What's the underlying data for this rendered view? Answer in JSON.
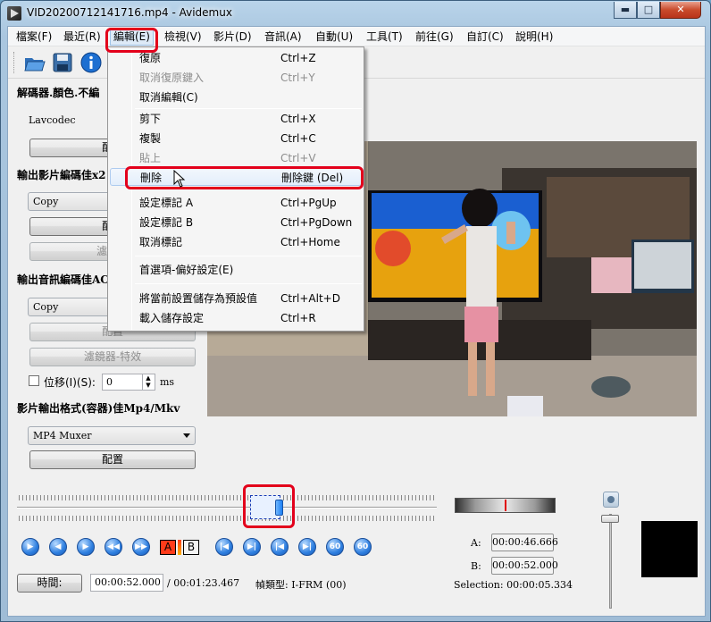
{
  "window": {
    "title": "VID20200712141716.mp4 - Avidemux",
    "minimize": "▬",
    "maximize": "□",
    "close": "✕"
  },
  "menubar": [
    "檔案(F)",
    "最近(R)",
    "編輯(E)",
    "檢視(V)",
    "影片(D)",
    "音訊(A)",
    "自動(U)",
    "工具(T)",
    "前往(G)",
    "自訂(C)",
    "說明(H)"
  ],
  "toolbar": {
    "icons": [
      "open-folder-icon",
      "save-disk-icon",
      "info-icon"
    ]
  },
  "left_panel": {
    "decoder_title": "解碼器.顏色.不編",
    "decoder_name": "Lavcodec",
    "decoder_config": "配置",
    "video_out_title": "輸出影片編碼佳x2",
    "video_codec": "Copy",
    "video_config": "配置",
    "video_filters": "濾鏡器",
    "audio_out_title": "輸出音訊編碼佳AC",
    "audio_codec": "Copy",
    "audio_config": "配置",
    "audio_filters": "濾鏡器-特效",
    "shift_label": "位移(I)(S):",
    "shift_value": "0",
    "shift_unit": "ms",
    "container_title": "影片輸出格式(容器)佳Mp4/Mkv",
    "muxer": "MP4 Muxer",
    "muxer_config": "配置"
  },
  "edit_menu": {
    "items": [
      {
        "label": "復原",
        "key": "Ctrl+Z",
        "enabled": true
      },
      {
        "label": "取消復原鍵入",
        "key": "Ctrl+Y",
        "enabled": false
      },
      {
        "label": "取消編輯(C)",
        "key": "",
        "enabled": true
      },
      {
        "label": "剪下",
        "key": "Ctrl+X",
        "enabled": true
      },
      {
        "label": "複製",
        "key": "Ctrl+C",
        "enabled": true
      },
      {
        "label": "貼上",
        "key": "Ctrl+V",
        "enabled": false
      },
      {
        "label": "刪除",
        "key": "刪除鍵 (Del)",
        "enabled": true
      },
      {
        "label": "設定標記 A",
        "key": "Ctrl+PgUp",
        "enabled": true
      },
      {
        "label": "設定標記 B",
        "key": "Ctrl+PgDown",
        "enabled": true
      },
      {
        "label": "取消標記",
        "key": "Ctrl+Home",
        "enabled": true
      },
      {
        "label": "首選項-偏好設定(E)",
        "key": "",
        "enabled": true
      },
      {
        "label": "將當前設置儲存為預設值",
        "key": "Ctrl+Alt+D",
        "enabled": true
      },
      {
        "label": "載入儲存設定",
        "key": "Ctrl+R",
        "enabled": true
      }
    ]
  },
  "controls": {
    "marker_a_label": "A",
    "marker_b_label": "B",
    "a_label": "A:",
    "a_time": "00:00:46.666",
    "b_label": "B:",
    "b_time": "00:00:52.000",
    "selection": "Selection: 00:00:05.334",
    "time_button": "時間:",
    "current_time": "00:00:52.000",
    "total_time": "/ 00:01:23.467",
    "frame_type": "幀類型:  I-FRM (00)",
    "seek_knob_icon": "seek-knob-icon",
    "speaker_icon": "speaker-icon"
  },
  "colors": {
    "highlight_border": "#e3001b",
    "menu_hover": "#ddeaf7"
  }
}
